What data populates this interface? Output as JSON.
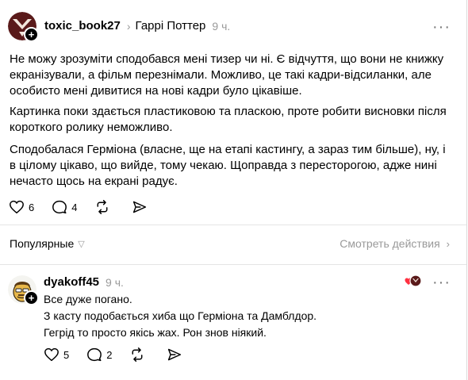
{
  "post": {
    "username": "toxic_book27",
    "topic": "Гаррі Поттер",
    "time": "9 ч.",
    "paragraphs": [
      "Не можу зрозуміти сподобався мені тизер чи ні. Є відчуття, що вони не книжку екранізували, а фільм перезнімали. Можливо, це такі кадри-відсиланки, але особисто мені дивитися на нові кадри було цікавіше.",
      "Картинка поки здається пластиковою та пласкою, проте робити висновки після короткого ролику неможливо.",
      "Сподобалася Герміона (власне, ще на етапі кастингу, а зараз тим більше), ну, і в цілому цікаво, що вийде, тому чекаю. Щоправда з пересторогою, адже нині нечасто щось на екрані радує."
    ],
    "likes": "6",
    "comments": "4",
    "icons": [
      "heart-icon",
      "comment-icon",
      "repost-icon",
      "share-icon",
      "more-icon"
    ]
  },
  "sort": {
    "label": "Популярные",
    "activity_link": "Смотреть действия"
  },
  "reply": {
    "username": "dyakoff45",
    "time": "9 ч.",
    "lines": [
      "Все дуже погано.",
      "З касту подобається хиба що Герміона та Дамблдор.",
      "Гегрід то просто якісь жах. Рон знов ніякий."
    ],
    "likes": "5",
    "comments": "2"
  },
  "colors": {
    "text": "#000000",
    "muted": "#999999",
    "divider": "#e5e5e5",
    "like_red": "#ff3040"
  }
}
